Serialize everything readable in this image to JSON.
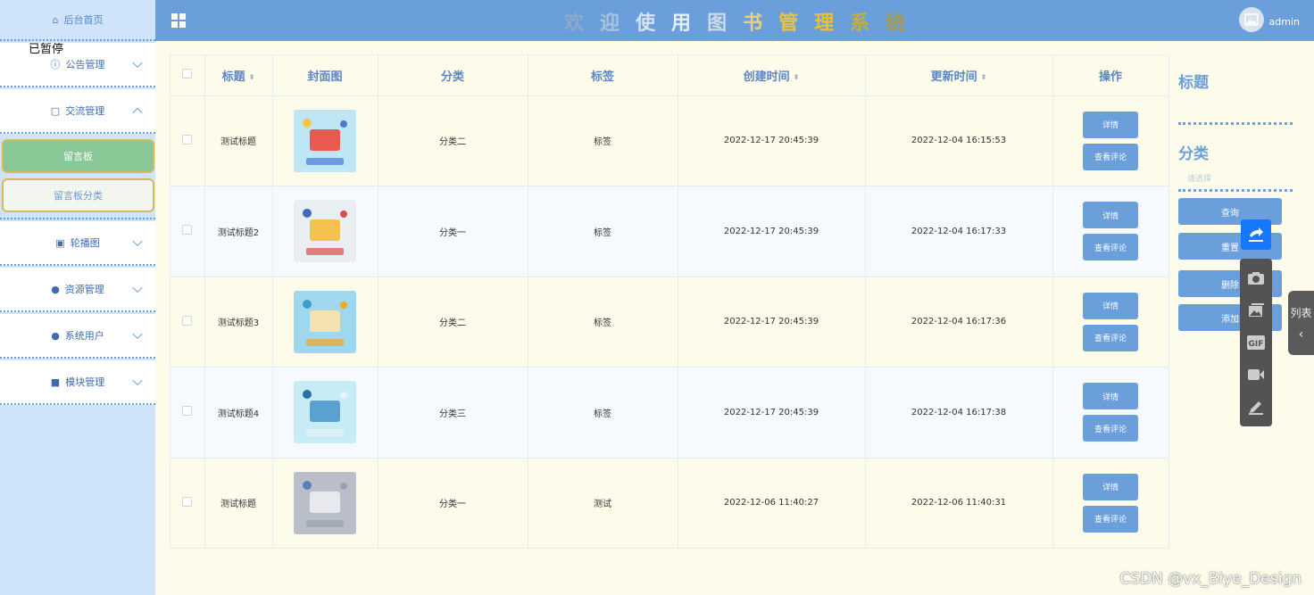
{
  "header": {
    "title_chars": [
      {
        "ch": "欢",
        "color": "#8fa9c8"
      },
      {
        "ch": "迎",
        "color": "#a9c3df"
      },
      {
        "ch": "使",
        "color": "#d7e3f1"
      },
      {
        "ch": "用",
        "color": "#e6eef7"
      },
      {
        "ch": "图",
        "color": "#cdd9e8"
      },
      {
        "ch": "书",
        "color": "#e8d37a"
      },
      {
        "ch": "管",
        "color": "#e6c24a"
      },
      {
        "ch": "理",
        "color": "#f0c02a"
      },
      {
        "ch": "系",
        "color": "#c8ac3c"
      },
      {
        "ch": "统",
        "color": "#a89a4a"
      }
    ],
    "user": "admin"
  },
  "overlay": {
    "paused_text": "已暂停",
    "side_tab_label": "列表",
    "watermark": "CSDN @vx_Biye_Design"
  },
  "sidebar": {
    "home": "后台首页",
    "groups": [
      {
        "label": "公告管理",
        "icon": "info-circle-icon",
        "glyph": "ⓘ",
        "expanded": false
      },
      {
        "label": "交流管理",
        "icon": "message-icon",
        "glyph": "▢",
        "expanded": true
      },
      {
        "label": "轮播图",
        "icon": "picture-icon",
        "glyph": "▣",
        "expanded": false
      },
      {
        "label": "资源管理",
        "icon": "location-icon",
        "glyph": "●",
        "expanded": false
      },
      {
        "label": "系统用户",
        "icon": "user-icon",
        "glyph": "●",
        "expanded": false
      },
      {
        "label": "模块管理",
        "icon": "grid-icon",
        "glyph": "■",
        "expanded": false
      }
    ],
    "subitems": [
      "留言板",
      "留言板分类"
    ]
  },
  "table": {
    "columns": [
      "标题",
      "封面图",
      "分类",
      "标签",
      "创建时间",
      "更新时间",
      "操作"
    ],
    "rows": [
      {
        "title": "测试标题",
        "category": "分类二",
        "tag": "标签",
        "created": "2022-12-17 20:45:39",
        "updated": "2022-12-04 16:15:53"
      },
      {
        "title": "测试标题2",
        "category": "分类一",
        "tag": "标签",
        "created": "2022-12-17 20:45:39",
        "updated": "2022-12-04 16:17:33"
      },
      {
        "title": "测试标题3",
        "category": "分类二",
        "tag": "标签",
        "created": "2022-12-17 20:45:39",
        "updated": "2022-12-04 16:17:36"
      },
      {
        "title": "测试标题4",
        "category": "分类三",
        "tag": "标签",
        "created": "2022-12-17 20:45:39",
        "updated": "2022-12-04 16:17:38"
      },
      {
        "title": "测试标题",
        "category": "分类一",
        "tag": "测试",
        "created": "2022-12-06 11:40:27",
        "updated": "2022-12-06 11:40:31"
      }
    ],
    "actions": {
      "detail": "详情",
      "comments": "查看评论"
    }
  },
  "search": {
    "title_label": "标题",
    "category_label": "分类",
    "category_placeholder": "请选择",
    "buttons": [
      "查询",
      "重置",
      "删除",
      "添加"
    ]
  }
}
